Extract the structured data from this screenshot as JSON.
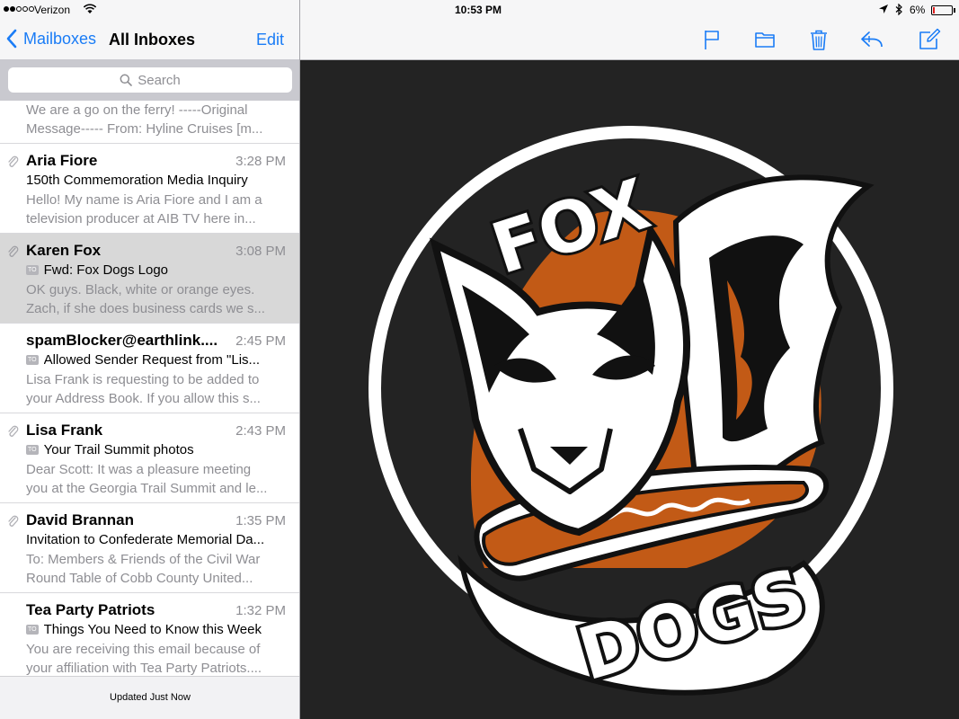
{
  "status": {
    "carrier": "Verizon",
    "time": "10:53 PM",
    "battery": "6%"
  },
  "nav": {
    "back_label": "Mailboxes",
    "title": "All Inboxes",
    "edit_label": "Edit"
  },
  "search": {
    "placeholder": "Search"
  },
  "emails": [
    {
      "preview1": "We are a go on the ferry! -----Original",
      "preview2": "Message----- From: Hyline Cruises [m..."
    },
    {
      "sender": "Aria Fiore",
      "time": "3:28 PM",
      "subject": "150th Commemoration Media Inquiry",
      "preview1": "Hello! My name is Aria Fiore and I am a",
      "preview2": "television producer at AIB TV here in..."
    },
    {
      "sender": "Karen Fox",
      "time": "3:08 PM",
      "badge": "TO",
      "subject": "Fwd: Fox Dogs Logo",
      "preview1": "OK guys. Black, white or orange eyes.",
      "preview2": "Zach, if she does business cards we s..."
    },
    {
      "sender": "spamBlocker@earthlink....",
      "time": "2:45 PM",
      "badge": "TO",
      "subject": "Allowed Sender Request from \"Lis...",
      "preview1": "Lisa Frank is requesting to be added to",
      "preview2": "your Address Book. If you allow this s..."
    },
    {
      "sender": "Lisa Frank",
      "time": "2:43 PM",
      "badge": "TO",
      "subject": "Your Trail Summit photos",
      "preview1": "Dear Scott: It was a pleasure meeting",
      "preview2": "you at the Georgia Trail Summit and le..."
    },
    {
      "sender": "David Brannan",
      "time": "1:35 PM",
      "subject": "Invitation to Confederate Memorial Da...",
      "preview1": "To: Members & Friends of the Civil War",
      "preview2": "Round Table of Cobb County United..."
    },
    {
      "sender": "Tea Party Patriots",
      "time": "1:32 PM",
      "badge": "TO",
      "subject": "Things You Need to Know this Week",
      "preview1": "You are receiving this email because of",
      "preview2": "your affiliation with Tea Party Patriots...."
    }
  ],
  "footer": {
    "updated": "Updated Just Now"
  },
  "logo": {
    "line1": "FOX",
    "line2": "DOGS"
  },
  "colors": {
    "accent": "#1a7cf6",
    "logo_orange": "#c25a16",
    "logo_bg": "#232323"
  }
}
